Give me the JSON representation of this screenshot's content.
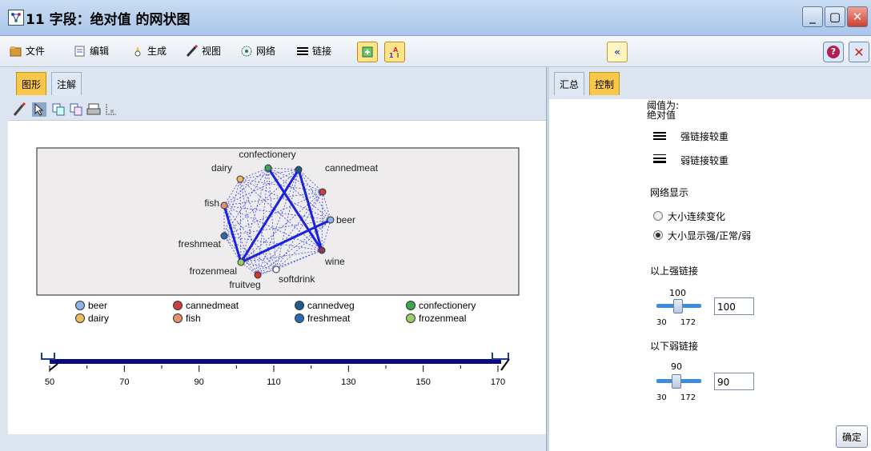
{
  "window": {
    "title": "11 字段：绝对值 的网状图"
  },
  "toolbar": {
    "items": [
      {
        "label": "文件",
        "icon": "file-folder-icon"
      },
      {
        "label": "编辑",
        "icon": "edit-icon"
      },
      {
        "label": "生成",
        "icon": "generate-icon"
      },
      {
        "label": "视图",
        "icon": "view-icon"
      },
      {
        "label": "网络",
        "icon": "network-icon"
      },
      {
        "label": "链接",
        "icon": "links-icon"
      }
    ],
    "collapse_symbol": "«",
    "help_symbol": "?",
    "close_symbol": "✕"
  },
  "left_tabs": [
    {
      "label": "图形"
    },
    {
      "label": "注解"
    }
  ],
  "right_tabs": [
    {
      "label": "汇总"
    },
    {
      "label": "控制"
    }
  ],
  "graph": {
    "nodes": [
      {
        "name": "confectionery",
        "color": "#3aa64a"
      },
      {
        "name": "cannedmeat",
        "color": "#c84040"
      },
      {
        "name": "cannedveg",
        "color": "#1f5c8a"
      },
      {
        "name": "beer",
        "color": "#8ab4e6"
      },
      {
        "name": "wine",
        "color": "#8a3a52"
      },
      {
        "name": "softdrink",
        "color": "#ffffff"
      },
      {
        "name": "fruitveg",
        "color": "#e03030"
      },
      {
        "name": "frozenmeal",
        "color": "#9bcb6a"
      },
      {
        "name": "freshmeat",
        "color": "#2a6ab0"
      },
      {
        "name": "fish",
        "color": "#e8926a"
      },
      {
        "name": "dairy",
        "color": "#f2b860"
      }
    ],
    "labels": {
      "confectionery": "confectionery",
      "dairy": "dairy",
      "cannedmeat": "cannedmeat",
      "fish": "fish",
      "beer": "beer",
      "freshmeat": "freshmeat",
      "wine": "wine",
      "frozenmeal": "frozenmeal",
      "fruitveg": "fruitveg",
      "softdrink": "softdrink"
    },
    "legend": [
      {
        "name": "beer",
        "color": "#8ab4e6"
      },
      {
        "name": "cannedmeat",
        "color": "#c84040"
      },
      {
        "name": "cannedveg",
        "color": "#1f5c8a"
      },
      {
        "name": "confectionery",
        "color": "#3aa64a"
      },
      {
        "name": "dairy",
        "color": "#f2b860"
      },
      {
        "name": "fish",
        "color": "#e8926a"
      },
      {
        "name": "freshmeat",
        "color": "#2a6ab0"
      },
      {
        "name": "frozenmeal",
        "color": "#9bcb6a"
      }
    ],
    "scale_ticks": [
      "50",
      "70",
      "90",
      "110",
      "130",
      "150",
      "170"
    ]
  },
  "controls": {
    "threshold_label": "阈值为:",
    "threshold_value": "绝对值",
    "strong_links_heavier": "强链接较重",
    "weak_links_heavier": "弱链接较重",
    "network_display": "网络显示",
    "radio_continuous": "大小连续变化",
    "radio_strong_normal_weak": "大小显示强/正常/弱",
    "strong_above_label": "以上强链接",
    "strong_value": "100",
    "strong_min": "30",
    "strong_max": "172",
    "strong_input": "100",
    "weak_below_label": "以下弱链接",
    "weak_value": "90",
    "weak_min": "30",
    "weak_max": "172",
    "weak_input": "90",
    "ok_button": "确定"
  }
}
